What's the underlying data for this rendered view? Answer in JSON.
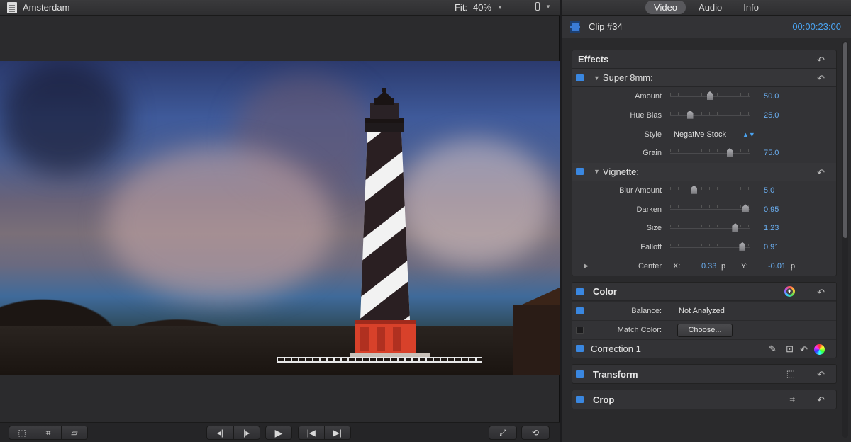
{
  "viewer": {
    "title": "Amsterdam",
    "fit_label": "Fit:",
    "fit_value": "40%"
  },
  "inspector": {
    "tabs": [
      "Video",
      "Audio",
      "Info"
    ],
    "active_tab": "Video",
    "clip_name": "Clip #34",
    "timecode": "00:00:23:00"
  },
  "effects": {
    "title": "Effects",
    "super8": {
      "title": "Super 8mm:",
      "amount": {
        "label": "Amount",
        "value": "50.0",
        "level": 0.5
      },
      "hue_bias": {
        "label": "Hue Bias",
        "value": "25.0",
        "level": 0.25
      },
      "style": {
        "label": "Style",
        "value": "Negative Stock"
      },
      "grain": {
        "label": "Grain",
        "value": "75.0",
        "level": 0.75
      }
    },
    "vignette": {
      "title": "Vignette:",
      "blur_amount": {
        "label": "Blur Amount",
        "value": "5.0",
        "level": 0.3
      },
      "darken": {
        "label": "Darken",
        "value": "0.95",
        "level": 0.95
      },
      "size": {
        "label": "Size",
        "value": "1.23",
        "level": 0.82
      },
      "falloff": {
        "label": "Falloff",
        "value": "0.91",
        "level": 0.91
      },
      "center": {
        "label": "Center",
        "x_label": "X:",
        "x_value": "0.33",
        "y_label": "Y:",
        "y_value": "-0.01",
        "unit": "p"
      }
    }
  },
  "color": {
    "title": "Color",
    "balance_label": "Balance:",
    "balance_value": "Not Analyzed",
    "match_label": "Match Color:",
    "choose_label": "Choose...",
    "correction_label": "Correction 1"
  },
  "transform": {
    "title": "Transform"
  },
  "crop": {
    "title": "Crop"
  },
  "colors": {
    "accent_blue": "#3a87e0",
    "value_blue": "#6aaef0",
    "lighthouse_base": "#d8412a"
  }
}
